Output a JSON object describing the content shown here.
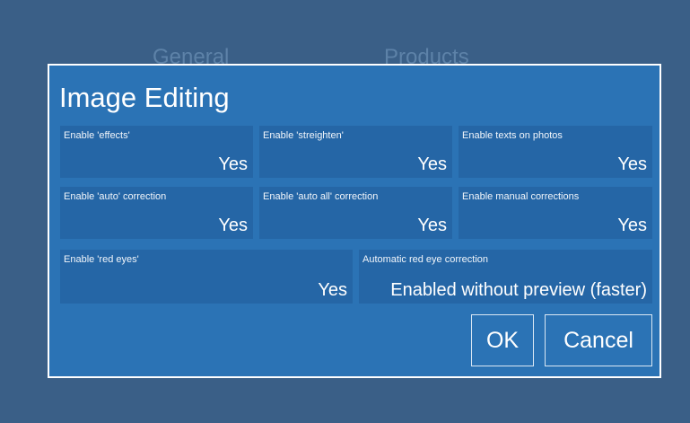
{
  "background_tabs": {
    "general": "General",
    "products": "Products"
  },
  "dialog": {
    "title": "Image Editing",
    "rows": [
      [
        {
          "label": "Enable 'effects'",
          "value": "Yes"
        },
        {
          "label": "Enable 'streighten'",
          "value": "Yes"
        },
        {
          "label": "Enable texts on photos",
          "value": "Yes"
        }
      ],
      [
        {
          "label": "Enable 'auto' correction",
          "value": "Yes"
        },
        {
          "label": "Enable 'auto all' correction",
          "value": "Yes"
        },
        {
          "label": "Enable manual corrections",
          "value": "Yes"
        }
      ],
      [
        {
          "label": "Enable 'red eyes'",
          "value": "Yes"
        },
        {
          "label": "Automatic red eye correction",
          "value": "Enabled without preview (faster)"
        }
      ]
    ],
    "ok_label": "OK",
    "cancel_label": "Cancel"
  },
  "colors": {
    "page_background": "#3a5f87",
    "dialog_background": "#2b73b5",
    "cell_background": "#2566a6",
    "text": "#ffffff"
  }
}
